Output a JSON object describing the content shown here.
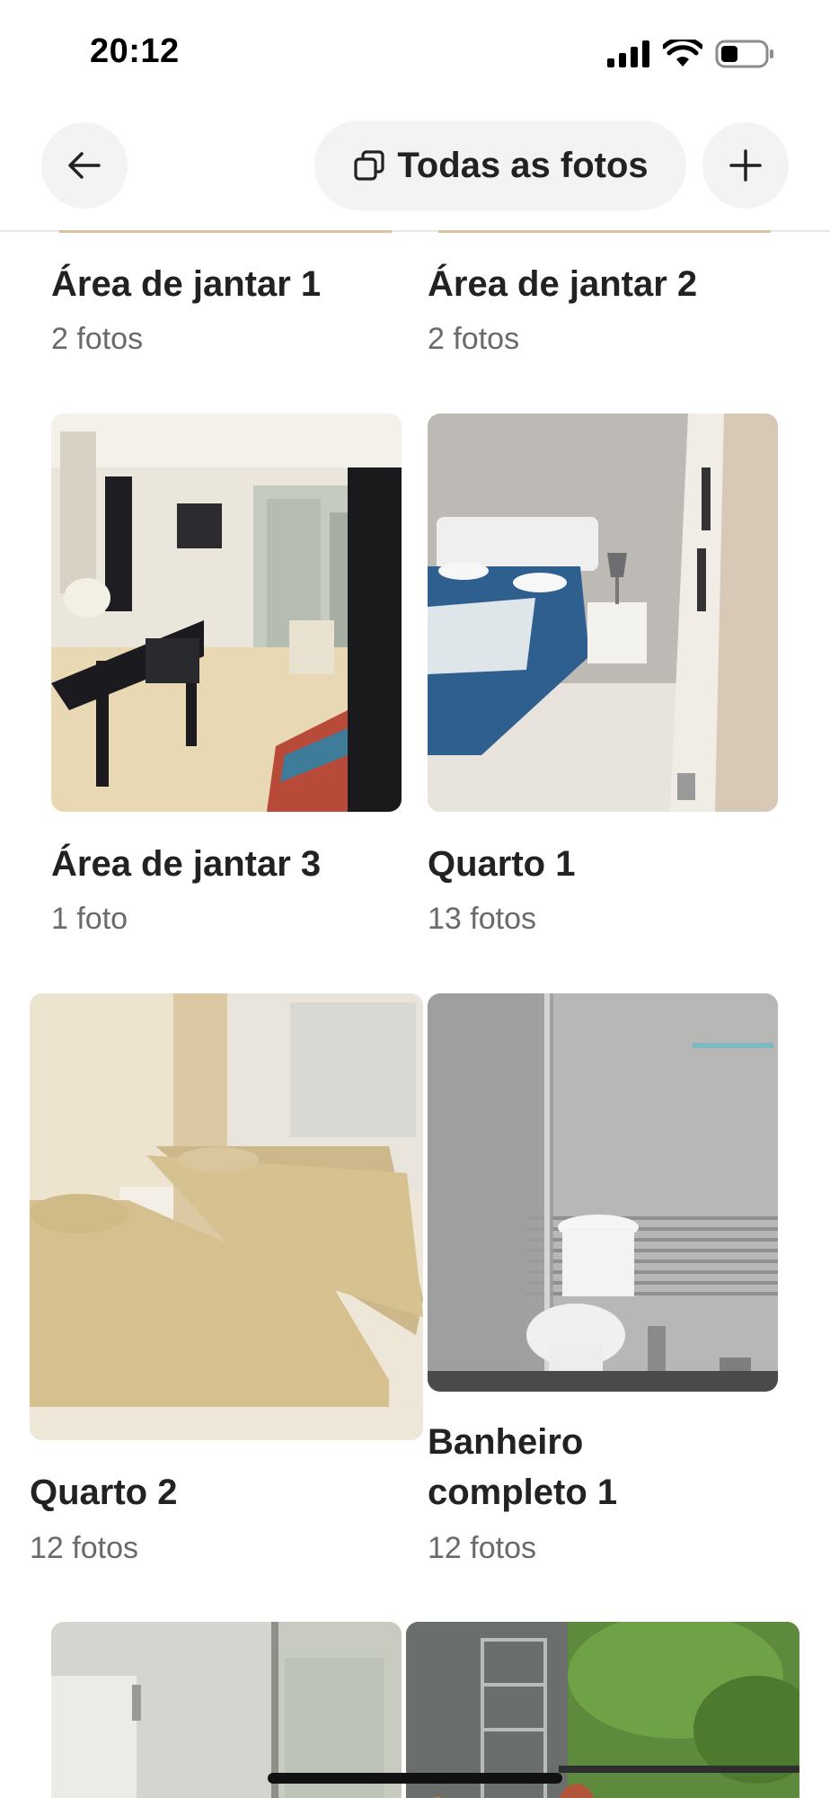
{
  "status_bar": {
    "time": "20:12"
  },
  "header": {
    "all_photos_label": "Todas as fotos"
  },
  "cards": [
    {
      "title": "Área de jantar 1",
      "count": "2 fotos"
    },
    {
      "title": "Área de jantar 2",
      "count": "2 fotos"
    },
    {
      "title": "Área de jantar 3",
      "count": "1 foto"
    },
    {
      "title": "Quarto 1",
      "count": "13 fotos"
    },
    {
      "title": "Quarto 2",
      "count": "12 fotos"
    },
    {
      "title_line1": "Banheiro",
      "title_line2": "completo 1",
      "count": "12 fotos"
    }
  ],
  "icons": [
    "cellular-signal-icon",
    "wifi-icon",
    "battery-icon",
    "back-arrow-icon",
    "photos-stack-icon",
    "plus-icon"
  ]
}
